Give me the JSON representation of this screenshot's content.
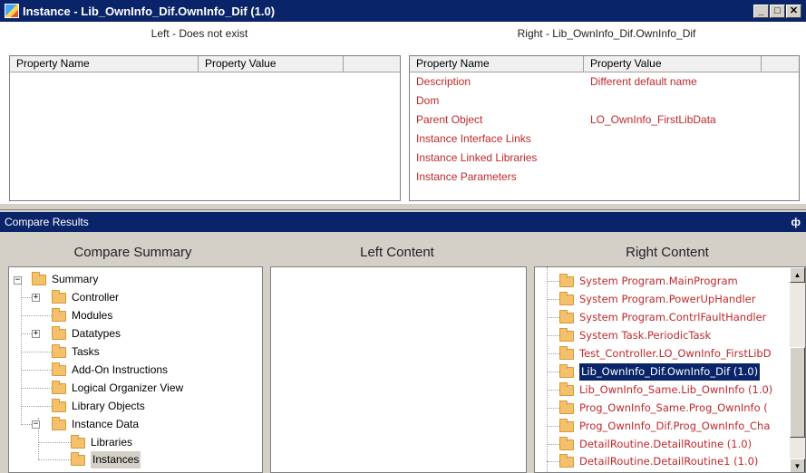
{
  "window": {
    "title": "Instance - Lib_OwnInfo_Dif.OwnInfo_Dif (1.0)",
    "minimize": "_",
    "maximize": "□",
    "close": "✕"
  },
  "instance": {
    "left": {
      "header": "Left - Does not exist",
      "columns": [
        "Property Name",
        "Property Value"
      ]
    },
    "right": {
      "header": "Right - Lib_OwnInfo_Dif.OwnInfo_Dif",
      "columns": [
        "Property Name",
        "Property Value"
      ],
      "rows": [
        {
          "name": "Description",
          "value": "Different default name"
        },
        {
          "name": "Dom",
          "value": ""
        },
        {
          "name": "Parent Object",
          "value": "LO_OwnInfo_FirstLibData"
        },
        {
          "name": "Instance Interface Links",
          "value": ""
        },
        {
          "name": "Instance Linked Libraries",
          "value": ""
        },
        {
          "name": "Instance Parameters",
          "value": ""
        }
      ]
    }
  },
  "compare": {
    "title": "Compare Results",
    "pin": "ф",
    "summary_header": "Compare Summary",
    "left_header": "Left Content",
    "right_header": "Right Content",
    "tree": {
      "root": "Summary",
      "items": [
        "Controller",
        "Modules",
        "Datatypes",
        "Tasks",
        "Add-On Instructions",
        "Logical Organizer View",
        "Library Objects",
        "Instance Data"
      ],
      "children": [
        "Libraries",
        "Instances"
      ]
    },
    "right_items": [
      "System Program.MainProgram",
      "System Program.PowerUpHandler",
      "System Program.ContrlFaultHandler",
      "System Task.PeriodicTask",
      "Test_Controller.LO_OwnInfo_FirstLibD",
      "Lib_OwnInfo_Dif.OwnInfo_Dif (1.0)",
      "Lib_OwnInfo_Same.Lib_OwnInfo (1.0)",
      "Prog_OwnInfo_Same.Prog_OwnInfo (",
      "Prog_OwnInfo_Dif.Prog_OwnInfo_Cha",
      "DetailRoutine.DetailRoutine (1.0)",
      "DetailRoutine.DetailRoutine1 (1.0)"
    ],
    "right_selected": "Lib_OwnInfo_Dif.OwnInfo_Dif (1.0)",
    "tree_selected": "Instances"
  }
}
